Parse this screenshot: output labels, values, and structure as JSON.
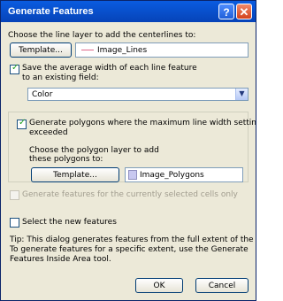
{
  "window": {
    "title": "Generate Features",
    "help_label": "?",
    "close_label": "✕"
  },
  "line_layer": {
    "prompt": "Choose the line layer to add the centerlines to:",
    "template_button": "Template...",
    "value": "Image_Lines"
  },
  "width_field": {
    "checkbox_label_1": "Save the average width of each line feature",
    "checkbox_label_2": "to an existing field:",
    "checked": true,
    "selected_value": "Color",
    "dropdown_icon": "chevron-down-icon"
  },
  "polygons": {
    "checkbox_label_1": "Generate polygons where the maximum line width setting is",
    "checkbox_label_2": "exceeded",
    "checked": true,
    "prompt_1": "Choose the polygon layer to add",
    "prompt_2": "these polygons to:",
    "template_button": "Template...",
    "value": "Image_Polygons"
  },
  "selected_cells": {
    "label": "Generate features for the currently selected cells only",
    "checked": false,
    "enabled": false
  },
  "select_new": {
    "label": "Select the new features",
    "checked": false
  },
  "tip": {
    "line1": "Tip:  This dialog generates features from the full extent of the raster.",
    "line2": "To generate features for a specific extent, use the Generate",
    "line3": "Features Inside Area tool."
  },
  "buttons": {
    "ok": "OK",
    "cancel": "Cancel"
  },
  "colors": {
    "title_bar": "#0a5ce0",
    "dialog_bg": "#ece9d8",
    "line_swatch": "#e06a8a",
    "polygon_swatch": "#c8c8f0"
  }
}
